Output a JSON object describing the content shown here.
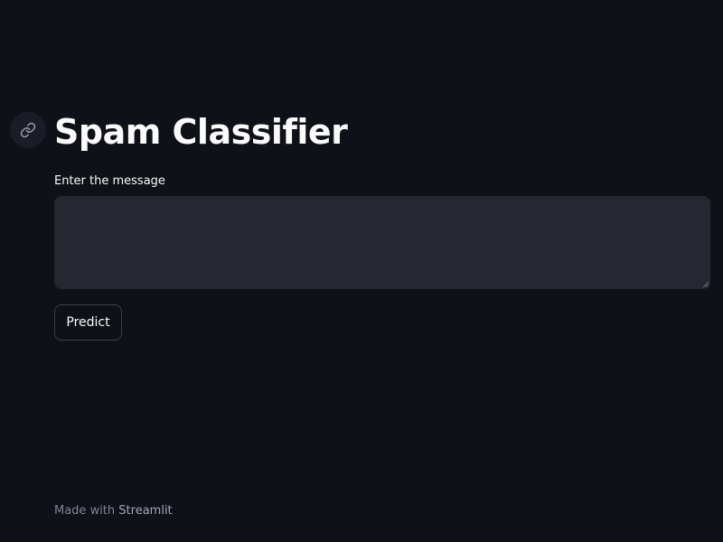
{
  "page": {
    "title": "Spam Classifier",
    "anchor_icon": "link-icon"
  },
  "form": {
    "message_label": "Enter the message",
    "message_value": "",
    "predict_label": "Predict"
  },
  "footer": {
    "made_with": "Made with",
    "brand": "Streamlit"
  },
  "colors": {
    "background": "#0e1117",
    "input_background": "#262730",
    "text": "#fafafa",
    "muted": "#808495"
  }
}
